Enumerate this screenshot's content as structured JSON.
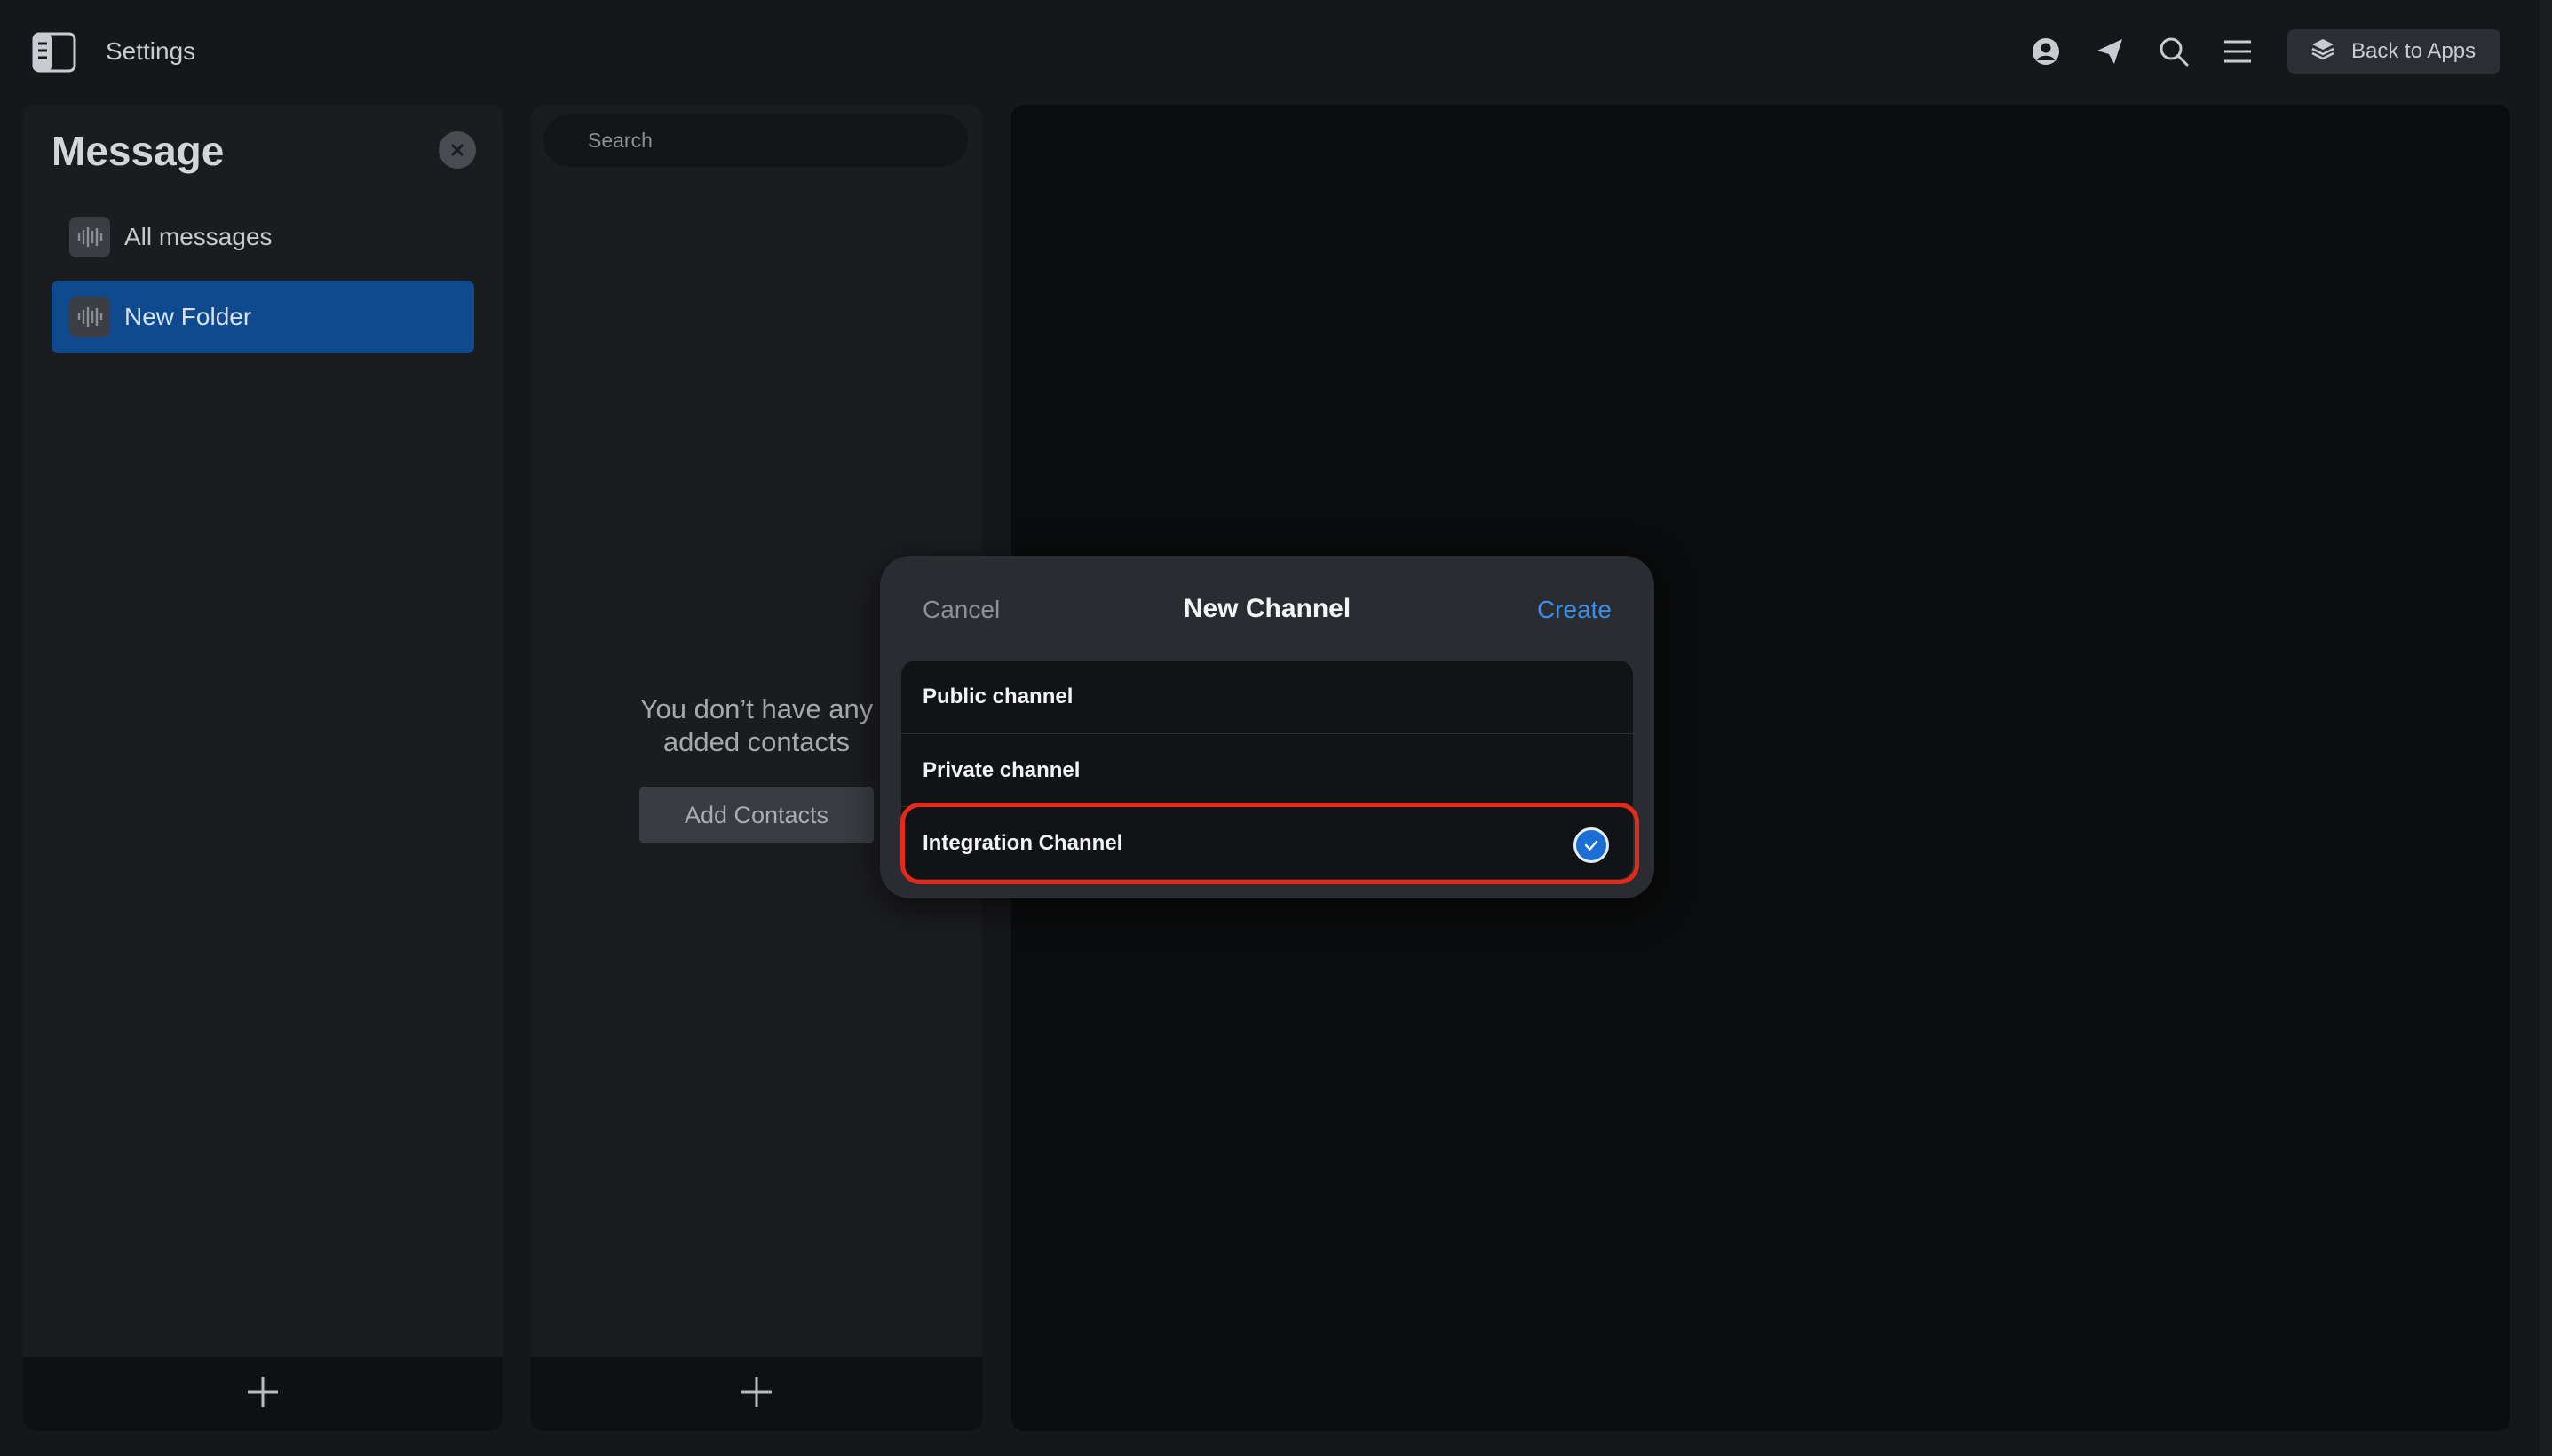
{
  "topbar": {
    "title": "Settings",
    "back_label": "Back to Apps",
    "icons": [
      "sidebar-toggle-icon",
      "user-icon",
      "send-icon",
      "search-icon",
      "menu-icon",
      "layers-icon"
    ]
  },
  "left_panel": {
    "title": "Message",
    "items": [
      {
        "label": "All messages"
      },
      {
        "label": "New Folder"
      }
    ]
  },
  "mid_panel": {
    "search_placeholder": "Search",
    "empty_line1": "You don’t have any",
    "empty_line2": "added contacts",
    "add_contacts": "Add Contacts"
  },
  "modal": {
    "cancel": "Cancel",
    "title": "New Channel",
    "create": "Create",
    "options": [
      {
        "label": "Public channel",
        "selected": false
      },
      {
        "label": "Private channel",
        "selected": false
      },
      {
        "label": "Integration Channel",
        "selected": true
      }
    ]
  },
  "colors": {
    "accent": "#3a8fe8",
    "selected_folder": "#0f4a8e",
    "highlight": "#e52a1a"
  }
}
